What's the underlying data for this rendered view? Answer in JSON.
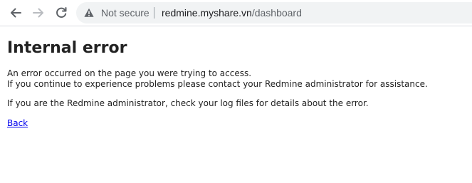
{
  "browser": {
    "back_icon": "arrow-left-icon",
    "forward_icon": "arrow-right-icon",
    "reload_icon": "reload-icon",
    "security_icon": "warning-triangle-icon",
    "security_label": "Not secure",
    "url_host": "redmine.myshare.vn",
    "url_path": "/dashboard"
  },
  "page": {
    "title": "Internal error",
    "line1": "An error occurred on the page you were trying to access.",
    "line2": "If you continue to experience problems please contact your Redmine administrator for assistance.",
    "line3": "If you are the Redmine administrator, check your log files for details about the error.",
    "back_label": "Back"
  },
  "colors": {
    "link": "#0000ee",
    "text": "#222222",
    "omnibox_bg": "#f1f3f4"
  }
}
